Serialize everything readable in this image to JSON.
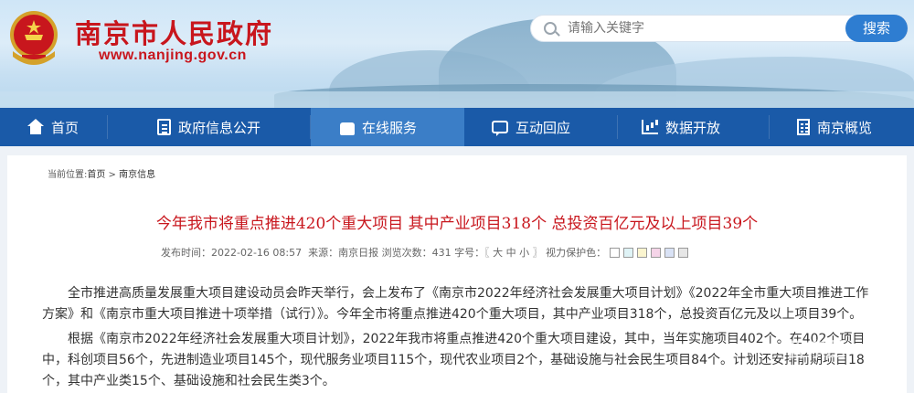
{
  "header": {
    "site_title": "南京市人民政府",
    "site_url": "www.nanjing.gov.cn",
    "search": {
      "placeholder": "请输入关键字",
      "button_label": "搜索"
    }
  },
  "nav": {
    "items": [
      {
        "label": "首页",
        "icon": "home-icon"
      },
      {
        "label": "政府信息公开",
        "icon": "document-icon"
      },
      {
        "label": "在线服务",
        "icon": "thumbs-up-icon",
        "active": true
      },
      {
        "label": "互动回应",
        "icon": "chat-icon"
      },
      {
        "label": "数据开放",
        "icon": "chart-icon"
      },
      {
        "label": "南京概览",
        "icon": "building-icon"
      }
    ]
  },
  "breadcrumb": {
    "prefix": "当前位置:",
    "home": "首页",
    "sep": " > ",
    "current": "南京信息"
  },
  "article": {
    "title": "今年我市将重点推进420个重大项目  其中产业项目318个  总投资百亿元及以上项目39个",
    "meta": {
      "published": "发布时间：2022-02-16 08:57",
      "source": "来源：南京日报",
      "views": "浏览次数：431",
      "font_size": "字号：〖 大 中 小 〗",
      "eye_care": "视力保护色：",
      "swatch_colors": [
        "#ffffff",
        "#dff3f6",
        "#fbf5cf",
        "#f5d4e8",
        "#d9e2f5",
        "#e6e6e6"
      ]
    },
    "paragraphs": [
      "全市推进高质量发展重大项目建设动员会昨天举行，会上发布了《南京市2022年经济社会发展重大项目计划》《2022年全市重大项目推进工作方案》和《南京市重大项目推进十项举措（试行）》。今年全市将重点推进420个重大项目，其中产业项目318个，总投资百亿元及以上项目39个。",
      "根据《南京市2022年经济社会发展重大项目计划》，2022年我市将重点推进420个重大项目建设，其中，当年实施项目402个。在402个项目中，科创项目56个，先进制造业项目145个，现代服务业项目115个，现代农业项目2个，基础设施与社会民生项目84个。计划还安排前期项目18个，其中产业类15个、基础设施和社会民生类3个。"
    ]
  },
  "watermark": "智东西"
}
